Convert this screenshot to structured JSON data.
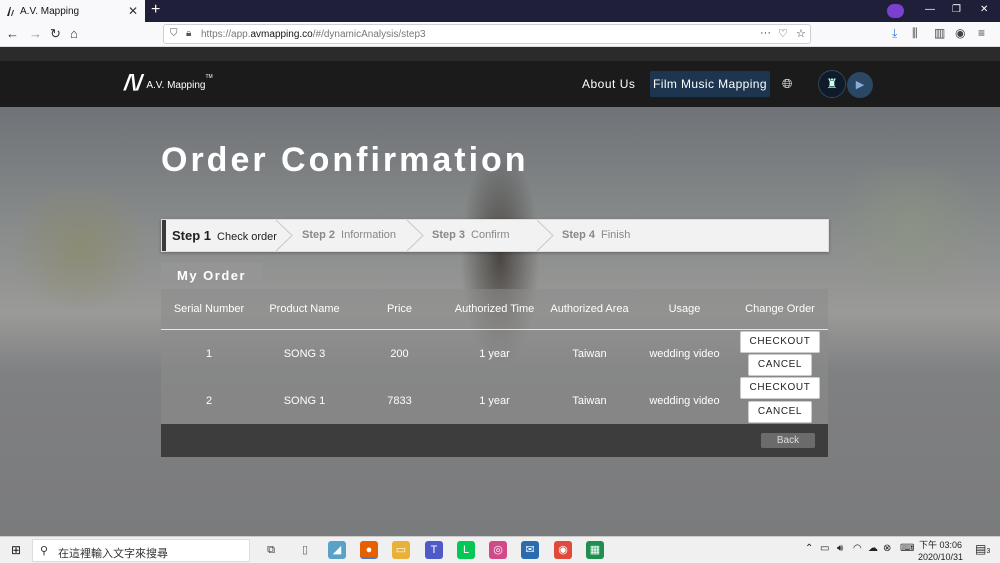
{
  "browser": {
    "tab_title": "A.V. Mapping",
    "tab_close": "✕",
    "new_tab": "+",
    "url_prefix": "https://app.",
    "url_domain": "avmapping.co",
    "url_path": "/#/dynamicAnalysis/step3"
  },
  "site": {
    "logo_mark": "/\\/",
    "logo_name": "A.V. Mapping",
    "logo_tm": "TM",
    "nav_about": "About Us",
    "nav_film": "Film Music Mapping"
  },
  "page": {
    "title": "Order Confirmation",
    "steps": [
      {
        "num": "Step 1",
        "label": "Check order",
        "active": true
      },
      {
        "num": "Step 2",
        "label": "Information",
        "active": false
      },
      {
        "num": "Step 3",
        "label": "Confirm",
        "active": false
      },
      {
        "num": "Step 4",
        "label": "Finish",
        "active": false
      }
    ],
    "order_tab": "My Order",
    "columns": [
      "Serial Number",
      "Product Name",
      "Price",
      "Authorized Time",
      "Authorized Area",
      "Usage",
      "Change Order"
    ],
    "rows": [
      {
        "serial": "1",
        "product": "SONG 3",
        "price": "200",
        "time": "1 year",
        "area": "Taiwan",
        "usage": "wedding video"
      },
      {
        "serial": "2",
        "product": "SONG 1",
        "price": "7833",
        "time": "1 year",
        "area": "Taiwan",
        "usage": "wedding video"
      }
    ],
    "checkout_label": "CHECKOUT",
    "cancel_label": "CANCEL",
    "back_label": "Back"
  },
  "taskbar": {
    "search_placeholder": "在這裡輸入文字來搜尋",
    "time": "下午 03:06",
    "date": "2020/10/31",
    "notif_count": "3"
  }
}
